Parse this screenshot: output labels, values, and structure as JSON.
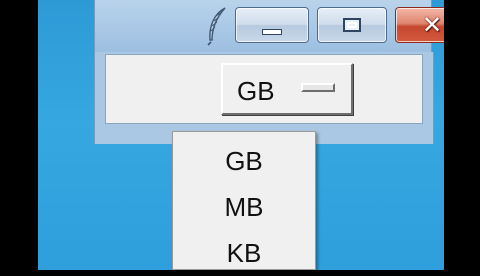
{
  "window": {
    "app_icon": "feather-icon",
    "buttons": {
      "minimize": "minimize-icon",
      "maximize": "maximize-icon",
      "close": "close-icon"
    }
  },
  "option_menu": {
    "selected": "GB",
    "options": [
      "GB",
      "MB",
      "KB"
    ]
  },
  "colors": {
    "desktop": "#2f9fdc",
    "titlebar": "#a9c8e6",
    "close_button": "#c5472f",
    "client_bg": "#f0f0f0"
  }
}
